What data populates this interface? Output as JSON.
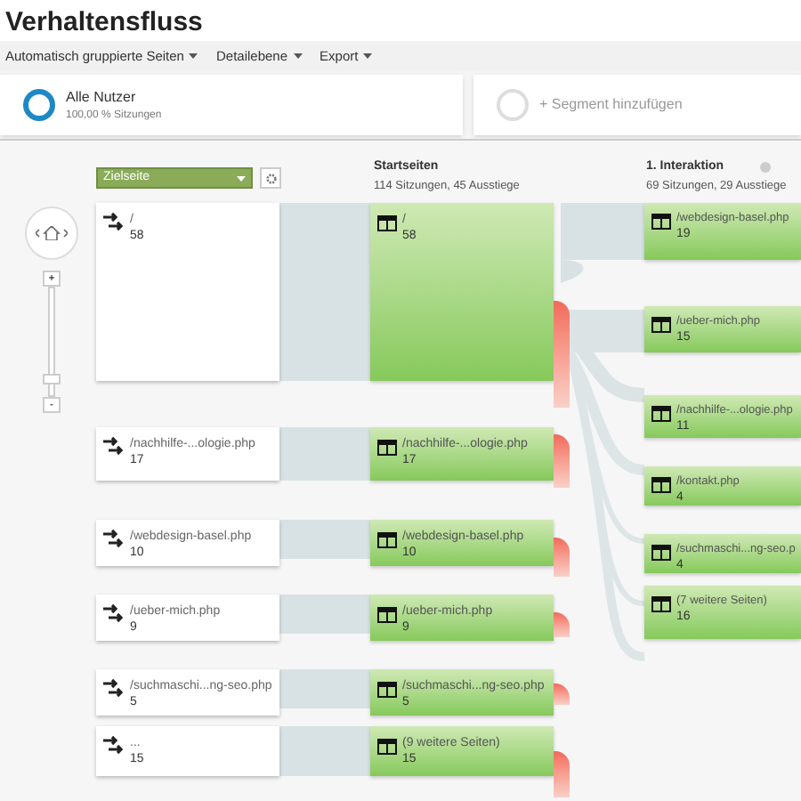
{
  "title": "Verhaltensfluss",
  "toolbar": [
    {
      "label": "Automatisch gruppierte Seiten"
    },
    {
      "label": "Detailebene"
    },
    {
      "label": "Export"
    }
  ],
  "segments": [
    {
      "kind": "active",
      "name": "Alle Nutzer",
      "detail": "100,00 % Sitzungen"
    },
    {
      "kind": "add",
      "name": "+ Segment hinzufügen"
    }
  ],
  "dimension_select": {
    "value": "Zielseite"
  },
  "zoom": {
    "plus": "+",
    "minus": "-",
    "level": 0.1
  },
  "columns": [
    {
      "title": "Startseiten",
      "summary": "114 Sitzungen, 45 Ausstiege"
    },
    {
      "title": "1. Interaktion",
      "summary": "69 Sitzungen, 29 Ausstiege"
    }
  ],
  "sources": [
    {
      "page": "/",
      "count": "58"
    },
    {
      "page": "/nachhilfe-...ologie.php",
      "count": "17"
    },
    {
      "page": "/webdesign-basel.php",
      "count": "10"
    },
    {
      "page": "/ueber-mich.php",
      "count": "9"
    },
    {
      "page": "/suchmaschi...ng-seo.php",
      "count": "5"
    },
    {
      "page": "...",
      "count": "15"
    }
  ],
  "start_pages": [
    {
      "page": "/",
      "count": "58"
    },
    {
      "page": "/nachhilfe-...ologie.php",
      "count": "17"
    },
    {
      "page": "/webdesign-basel.php",
      "count": "10"
    },
    {
      "page": "/ueber-mich.php",
      "count": "9"
    },
    {
      "page": "/suchmaschi...ng-seo.php",
      "count": "5"
    },
    {
      "page": "(9 weitere Seiten)",
      "count": "15"
    }
  ],
  "interactions": [
    {
      "page": "/webdesign-basel.php",
      "count": "19"
    },
    {
      "page": "/ueber-mich.php",
      "count": "15"
    },
    {
      "page": "/nachhilfe-...ologie.php",
      "count": "11"
    },
    {
      "page": "/kontakt.php",
      "count": "4"
    },
    {
      "page": "/suchmaschi...ng-seo.p",
      "count": "4"
    },
    {
      "page": "(7 weitere Seiten)",
      "count": "16"
    }
  ]
}
